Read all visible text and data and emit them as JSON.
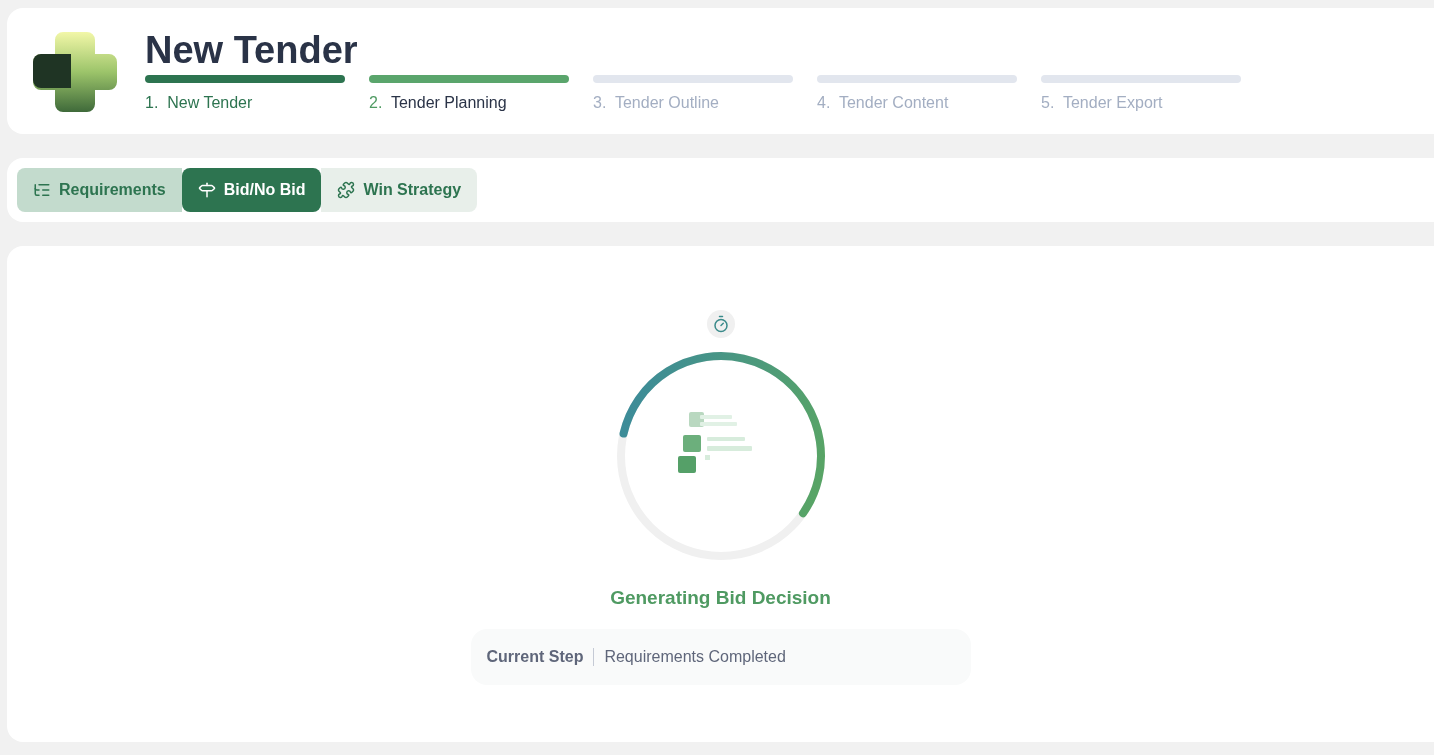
{
  "header": {
    "title": "New Tender",
    "steps": [
      {
        "number": "1.",
        "label": "New Tender",
        "selected": false
      },
      {
        "number": "2.",
        "label": "Tender Planning",
        "selected": true
      },
      {
        "number": "3.",
        "label": "Tender Outline",
        "selected": false
      },
      {
        "number": "4.",
        "label": "Tender Content",
        "selected": false
      },
      {
        "number": "5.",
        "label": "Tender Export",
        "selected": false
      }
    ]
  },
  "tabs": [
    {
      "label": "Requirements",
      "selected": false
    },
    {
      "label": "Bid/No Bid",
      "selected": true
    },
    {
      "label": "Win Strategy",
      "selected": false
    }
  ],
  "progress": {
    "level": 0.56,
    "title": "Generating Bid Decision",
    "step_label": "Current Step",
    "step_value": "Requirements Completed"
  }
}
